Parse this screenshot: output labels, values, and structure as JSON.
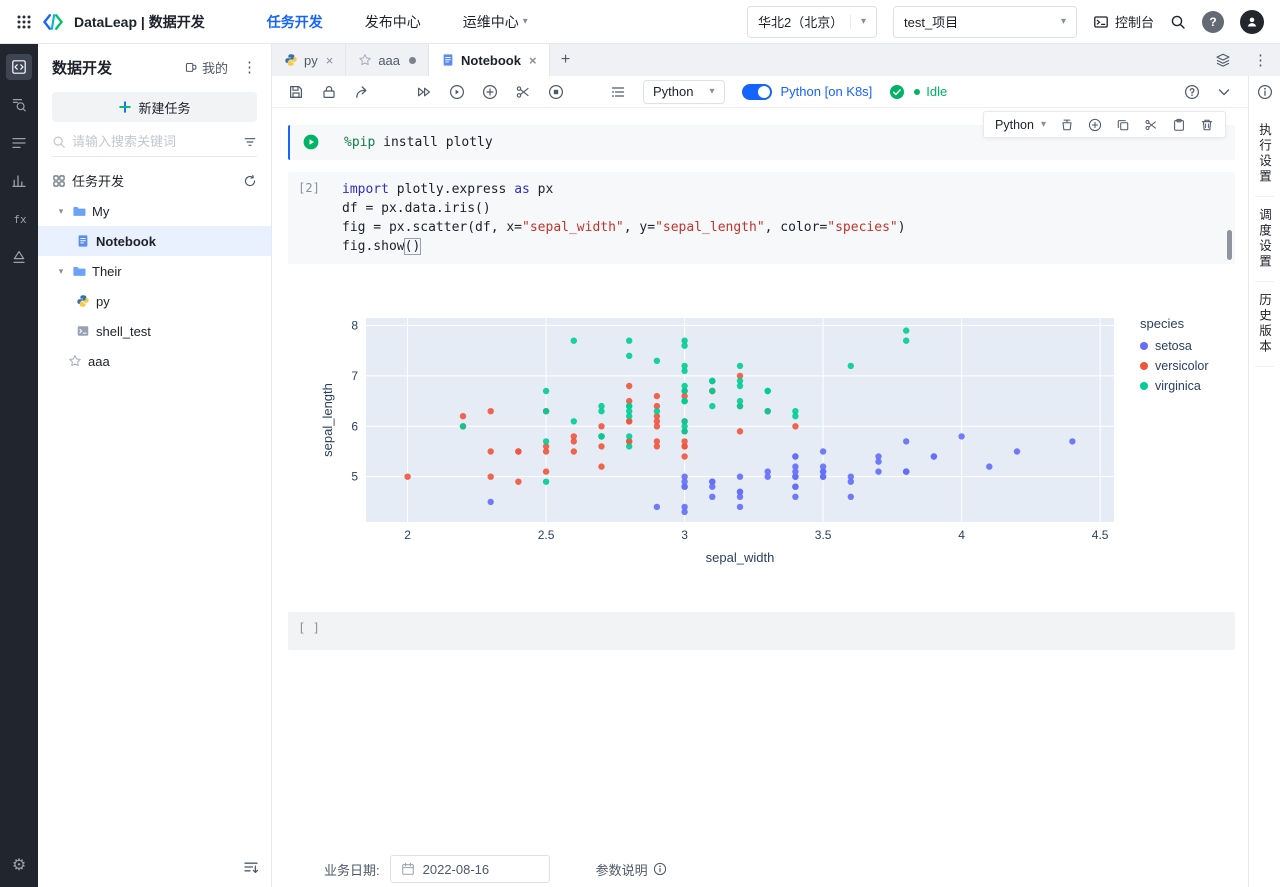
{
  "icons": {
    "caret_down": "▾",
    "close": "×",
    "plus": "+",
    "kebab": "⋮",
    "gear": "⚙",
    "question": "?"
  },
  "topbar": {
    "brand": "DataLeap | 数据开发",
    "nav": [
      {
        "label": "任务开发"
      },
      {
        "label": "发布中心"
      },
      {
        "label": "运维中心"
      }
    ],
    "region": "华北2（北京）",
    "project": "test_项目",
    "console": "控制台"
  },
  "sidebar": {
    "title": "数据开发",
    "scope": "我的",
    "new_task": "新建任务",
    "search_placeholder": "请输入搜索关键词",
    "section": "任务开发",
    "tree": [
      {
        "label": "My"
      },
      {
        "label": "Notebook"
      },
      {
        "label": "Their"
      },
      {
        "label": "py"
      },
      {
        "label": "shell_test"
      },
      {
        "label": "aaa"
      }
    ]
  },
  "tabs": [
    {
      "label": "py"
    },
    {
      "label": "aaa"
    },
    {
      "label": "Notebook"
    }
  ],
  "toolbar": {
    "kernel": "Python",
    "runtime": "Python [on K8s]",
    "status": "Idle"
  },
  "cell_toolbar": {
    "language": "Python"
  },
  "right_panel_tabs": [
    "执行设置",
    "调度设置",
    "历史版本"
  ],
  "notebook": {
    "cell1": {
      "tokens": [
        {
          "t": "%pip",
          "c": "magic"
        },
        {
          "t": " install plotly",
          "c": "plain"
        }
      ]
    },
    "cell2": {
      "gutter": "[2]",
      "line1": [
        {
          "t": "import",
          "c": "kw"
        },
        {
          "t": " plotly.express ",
          "c": "plain"
        },
        {
          "t": "as",
          "c": "kw"
        },
        {
          "t": " px",
          "c": "plain"
        }
      ],
      "line2": [
        {
          "t": "df = px.data.iris()",
          "c": "plain"
        }
      ],
      "line3": [
        {
          "t": "fig = px.scatter(df, x=",
          "c": "plain"
        },
        {
          "t": "\"sepal_width\"",
          "c": "str"
        },
        {
          "t": ", y=",
          "c": "plain"
        },
        {
          "t": "\"sepal_length\"",
          "c": "str"
        },
        {
          "t": ", color=",
          "c": "plain"
        },
        {
          "t": "\"species\"",
          "c": "str"
        },
        {
          "t": ")",
          "c": "plain"
        }
      ],
      "line4": [
        {
          "t": "fig.show",
          "c": "plain"
        },
        {
          "t": "()",
          "c": "bracket"
        }
      ]
    },
    "empty_cell_gutter": "[ ]"
  },
  "footer": {
    "date_label": "业务日期:",
    "date_value": "2022-08-16",
    "params_label": "参数说明"
  },
  "chart_data": {
    "type": "scatter",
    "xlabel": "sepal_width",
    "ylabel": "sepal_length",
    "legend_title": "species",
    "xlim": [
      1.85,
      4.55
    ],
    "ylim": [
      4.1,
      8.15
    ],
    "xticks": [
      2,
      2.5,
      3,
      3.5,
      4,
      4.5
    ],
    "yticks": [
      5,
      6,
      7,
      8
    ],
    "plot_bg": "#e5ecf6",
    "grid": true,
    "legend_position": "right",
    "series": [
      {
        "name": "setosa",
        "color": "#636efa",
        "x": [
          3.5,
          3.0,
          3.2,
          3.1,
          3.6,
          3.9,
          3.4,
          3.4,
          2.9,
          3.1,
          3.7,
          3.4,
          3.0,
          3.0,
          4.0,
          4.4,
          3.9,
          3.5,
          3.8,
          3.8,
          3.4,
          3.7,
          3.6,
          3.3,
          3.4,
          3.0,
          3.4,
          3.5,
          3.4,
          3.2,
          3.1,
          3.4,
          4.1,
          4.2,
          3.1,
          3.2,
          3.5,
          3.6,
          3.0,
          3.4,
          3.5,
          2.3,
          3.2,
          3.5,
          3.8,
          3.0,
          3.8,
          3.2,
          3.7,
          3.3
        ],
        "y": [
          5.1,
          4.9,
          4.7,
          4.6,
          5.0,
          5.4,
          4.6,
          5.0,
          4.4,
          4.9,
          5.4,
          4.8,
          4.8,
          4.3,
          5.8,
          5.7,
          5.4,
          5.1,
          5.7,
          5.1,
          5.4,
          5.1,
          4.6,
          5.1,
          4.8,
          5.0,
          5.0,
          5.2,
          5.2,
          4.7,
          4.8,
          5.4,
          5.2,
          5.5,
          4.9,
          5.0,
          5.5,
          4.9,
          4.4,
          5.1,
          5.0,
          4.5,
          4.4,
          5.0,
          5.1,
          4.8,
          5.1,
          4.6,
          5.3,
          5.0
        ]
      },
      {
        "name": "versicolor",
        "color": "#ef553b",
        "x": [
          3.2,
          3.2,
          3.1,
          2.3,
          2.8,
          2.8,
          3.3,
          2.4,
          2.9,
          2.7,
          2.0,
          3.0,
          2.2,
          2.9,
          2.9,
          3.1,
          3.0,
          2.7,
          2.2,
          2.5,
          3.2,
          2.8,
          2.5,
          2.8,
          2.9,
          3.0,
          2.8,
          3.0,
          2.9,
          2.6,
          2.4,
          2.4,
          2.7,
          2.7,
          3.0,
          3.4,
          3.1,
          2.3,
          3.0,
          2.5,
          2.6,
          3.0,
          2.6,
          2.3,
          2.7,
          3.0,
          2.9,
          2.9,
          2.5,
          2.8
        ],
        "y": [
          7.0,
          6.4,
          6.9,
          5.5,
          6.5,
          5.7,
          6.3,
          4.9,
          6.6,
          5.2,
          5.0,
          5.9,
          6.0,
          6.1,
          5.6,
          6.7,
          5.6,
          5.8,
          6.2,
          5.6,
          5.9,
          6.1,
          6.3,
          6.1,
          6.4,
          6.6,
          6.8,
          6.7,
          6.0,
          5.7,
          5.5,
          5.5,
          5.8,
          6.0,
          5.4,
          6.0,
          6.7,
          6.3,
          5.6,
          5.5,
          5.5,
          6.1,
          5.8,
          5.0,
          5.6,
          5.7,
          5.7,
          6.2,
          5.1,
          5.7
        ]
      },
      {
        "name": "virginica",
        "color": "#00cc96",
        "x": [
          3.3,
          2.7,
          3.0,
          2.9,
          3.0,
          3.0,
          2.5,
          2.9,
          2.5,
          3.6,
          3.2,
          2.7,
          3.0,
          2.5,
          2.8,
          3.2,
          3.0,
          3.8,
          2.6,
          2.2,
          3.2,
          2.8,
          2.8,
          2.7,
          3.3,
          3.2,
          2.8,
          3.0,
          2.8,
          3.0,
          2.8,
          3.8,
          2.8,
          2.8,
          2.6,
          3.0,
          3.4,
          3.1,
          3.0,
          3.1,
          3.1,
          3.1,
          2.7,
          3.2,
          3.3,
          3.0,
          2.5,
          3.0,
          3.4,
          3.0
        ],
        "y": [
          6.3,
          5.8,
          7.1,
          6.3,
          6.5,
          7.6,
          4.9,
          7.3,
          6.7,
          7.2,
          6.5,
          6.4,
          6.8,
          5.7,
          5.8,
          6.4,
          6.5,
          7.7,
          7.7,
          6.0,
          6.9,
          5.6,
          7.7,
          6.3,
          6.7,
          7.2,
          6.2,
          6.1,
          6.4,
          7.2,
          7.4,
          7.9,
          6.4,
          6.3,
          6.1,
          7.7,
          6.3,
          6.4,
          6.0,
          6.9,
          6.7,
          6.9,
          5.8,
          6.8,
          6.7,
          6.7,
          6.3,
          6.5,
          6.2,
          5.9
        ]
      }
    ]
  }
}
